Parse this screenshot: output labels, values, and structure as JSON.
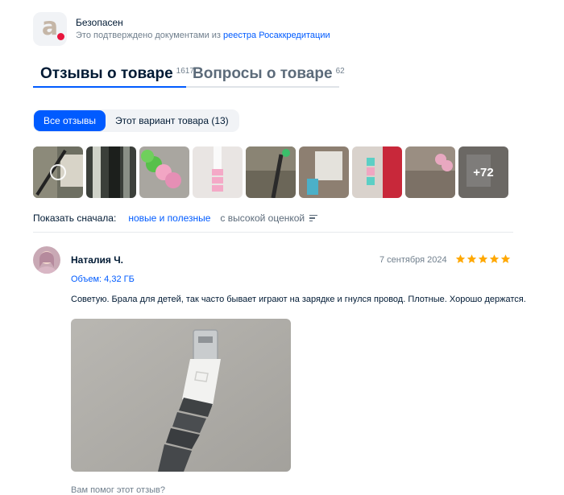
{
  "badge": {
    "icon": "ozon-safety-logo-icon",
    "title": "Безопасен",
    "subtitle_prefix": "Это подтверждено документами из ",
    "subtitle_link": "реестра Росаккредитации"
  },
  "tabs": [
    {
      "label": "Отзывы о товаре",
      "count": "1617",
      "active": true
    },
    {
      "label": "Вопросы о товаре",
      "count": "62",
      "active": false
    }
  ],
  "filters": {
    "all_reviews": "Все отзывы",
    "this_variant": "Этот вариант товара (13)"
  },
  "photos": {
    "more_count": "+72"
  },
  "sort": {
    "label": "Показать сначала:",
    "option_useful": "новые и полезные",
    "option_rating": "с высокой оценкой"
  },
  "review": {
    "author": "Наталия Ч.",
    "date": "7 сентября 2024",
    "rating": 5,
    "variant": "Объем: 4,32 ГБ",
    "text": "Советую. Брала для детей, так часто бывает играют на зарядке и гнулся провод. Плотные. Хорошо держатся.",
    "helpful_prompt": "Вам помог этот отзыв?"
  },
  "colors": {
    "accent": "#005bff",
    "star": "#ffa800",
    "text": "#001a34",
    "muted": "#707f8d"
  }
}
